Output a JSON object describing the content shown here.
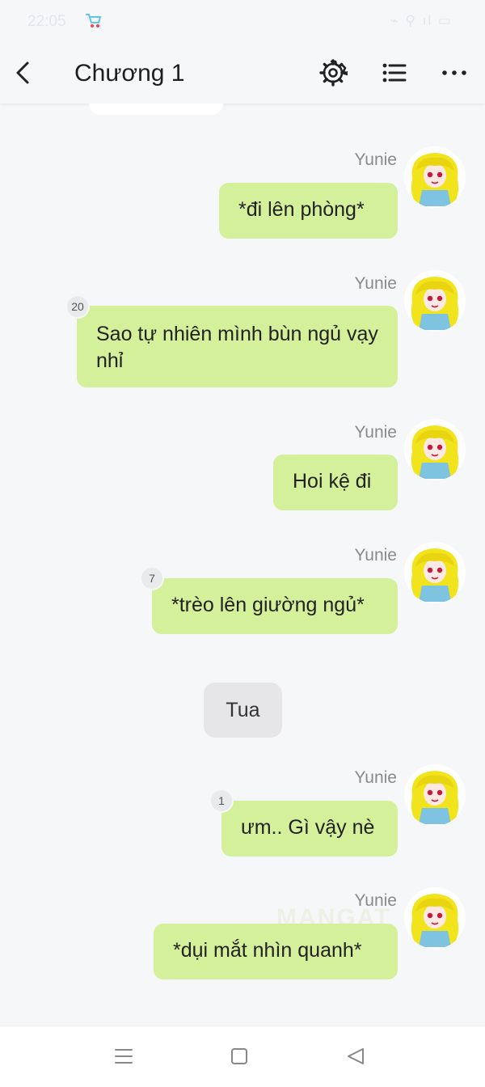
{
  "status_bar": {
    "time": "22:05",
    "right_text": "⌁ ⚲ ıl ▭"
  },
  "header": {
    "title": "Chương 1"
  },
  "messages": [
    {
      "name": "Yunie",
      "text": "*đi lên phòng*",
      "count": ""
    },
    {
      "name": "Yunie",
      "text": "Sao tự nhiên mình bùn ngủ vạy nhỉ",
      "count": "20"
    },
    {
      "name": "Yunie",
      "text": "Hoi kệ đi",
      "count": ""
    },
    {
      "name": "Yunie",
      "text": "*trèo lên giường ngủ*",
      "count": "7"
    },
    {
      "name": "Yunie",
      "text": "ưm.. Gì vậy nè",
      "count": "1"
    },
    {
      "name": "Yunie",
      "text": "*dụi mắt nhìn quanh*",
      "count": ""
    }
  ],
  "narration": {
    "text": "Tua"
  },
  "watermark": "MANGAT",
  "icons": {
    "back": "chevron-left-icon",
    "settings": "gear-icon",
    "list": "list-icon",
    "more": "more-dots-icon",
    "nav_menu": "menu-icon",
    "nav_home": "square-icon",
    "nav_back": "triangle-back-icon"
  },
  "colors": {
    "bubble": "#d5f09b",
    "narration_bubble": "#e6e6e8",
    "background": "#f6f7f9",
    "hair": "#f2e41c"
  }
}
